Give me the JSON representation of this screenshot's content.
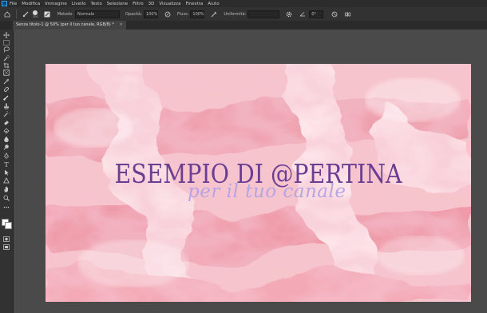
{
  "app": {
    "logo": "Ps"
  },
  "menu": [
    "File",
    "Modifica",
    "Immagine",
    "Livello",
    "Testo",
    "Selezione",
    "Filtro",
    "3D",
    "Visualizza",
    "Finestra",
    "Aiuto"
  ],
  "options": {
    "brush_size": "200",
    "mode_label": "Metodo:",
    "mode_value": "Normale",
    "opacity_label": "Opacità:",
    "opacity_value": "100%",
    "flow_label": "Fluss:",
    "flow_value": "100%",
    "smoothing_label": "Uniformità:",
    "smoothing_value": "",
    "angle_value": "0°"
  },
  "document": {
    "tab_title": "Senza titolo-1 @ 50% (per il tuo canale, RGB/8) *",
    "tab_close": "×"
  },
  "canvas": {
    "title": "ESEMPIO DI @PERTINA",
    "subtitle": "per il tuo canale",
    "title_color": "#6b3e93",
    "subtitle_color": "#b6a5e3"
  },
  "tools": [
    "move-tool",
    "artboard-tool",
    "marquee-tool",
    "lasso-tool",
    "quick-select-tool",
    "crop-tool",
    "frame-tool",
    "eyedropper-tool",
    "healing-brush-tool",
    "brush-tool",
    "clone-stamp-tool",
    "history-brush-tool",
    "eraser-tool",
    "gradient-tool",
    "blur-tool",
    "dodge-tool",
    "pen-tool",
    "type-tool",
    "path-select-tool",
    "shape-tool",
    "hand-tool",
    "zoom-tool",
    "more-tools",
    "color-swatches",
    "quick-mask",
    "screen-mode"
  ]
}
